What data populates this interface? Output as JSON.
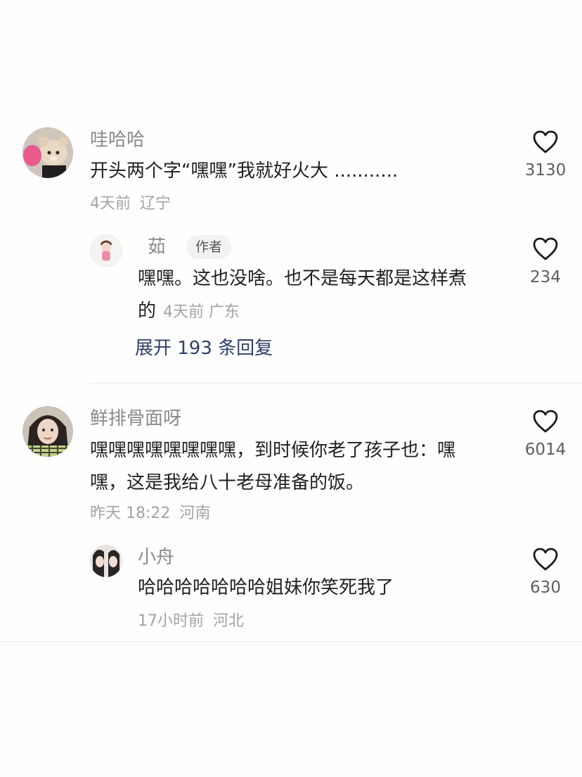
{
  "comments": [
    {
      "username": "哇哈哈",
      "text": "开头两个字“嘿嘿”我就好火大 ...........",
      "time": "4天前",
      "location": "辽宁",
      "likes": "3130",
      "reply": {
        "username": "茹",
        "badge": "作者",
        "text": "嘿嘿。这也没啥。也不是每天都是这样煮的",
        "text_line1": "嘿嘿。这也没啥。也不是每天都是这样煮",
        "text_line2": "的",
        "time": "4天前",
        "location": "广东",
        "likes": "234"
      },
      "expand_label": "展开 193 条回复"
    },
    {
      "username": "鲜排骨面呀",
      "text": "嘿嘿嘿嘿嘿嘿嘿嘿，到时候你老了孩子也：嘿嘿，这是我给八十老母准备的饭。",
      "text_line1": "嘿嘿嘿嘿嘿嘿嘿嘿，到时候你老了孩子也：嘿",
      "text_line2": "嘿，这是我给八十老母准备的饭。",
      "time": "昨天 18:22",
      "location": "河南",
      "likes": "6014",
      "reply": {
        "username": "小舟",
        "text": "哈哈哈哈哈哈哈姐妹你笑死我了",
        "time": "17小时前",
        "location": "河北",
        "likes": "630"
      }
    }
  ],
  "icons": {
    "like": "heart-outline-icon"
  },
  "colors": {
    "username": "#8a8a8a",
    "text": "#1f1f1f",
    "meta": "#a3a3a3",
    "expand_link": "#2f4168",
    "badge_bg": "#f2f2f2"
  }
}
